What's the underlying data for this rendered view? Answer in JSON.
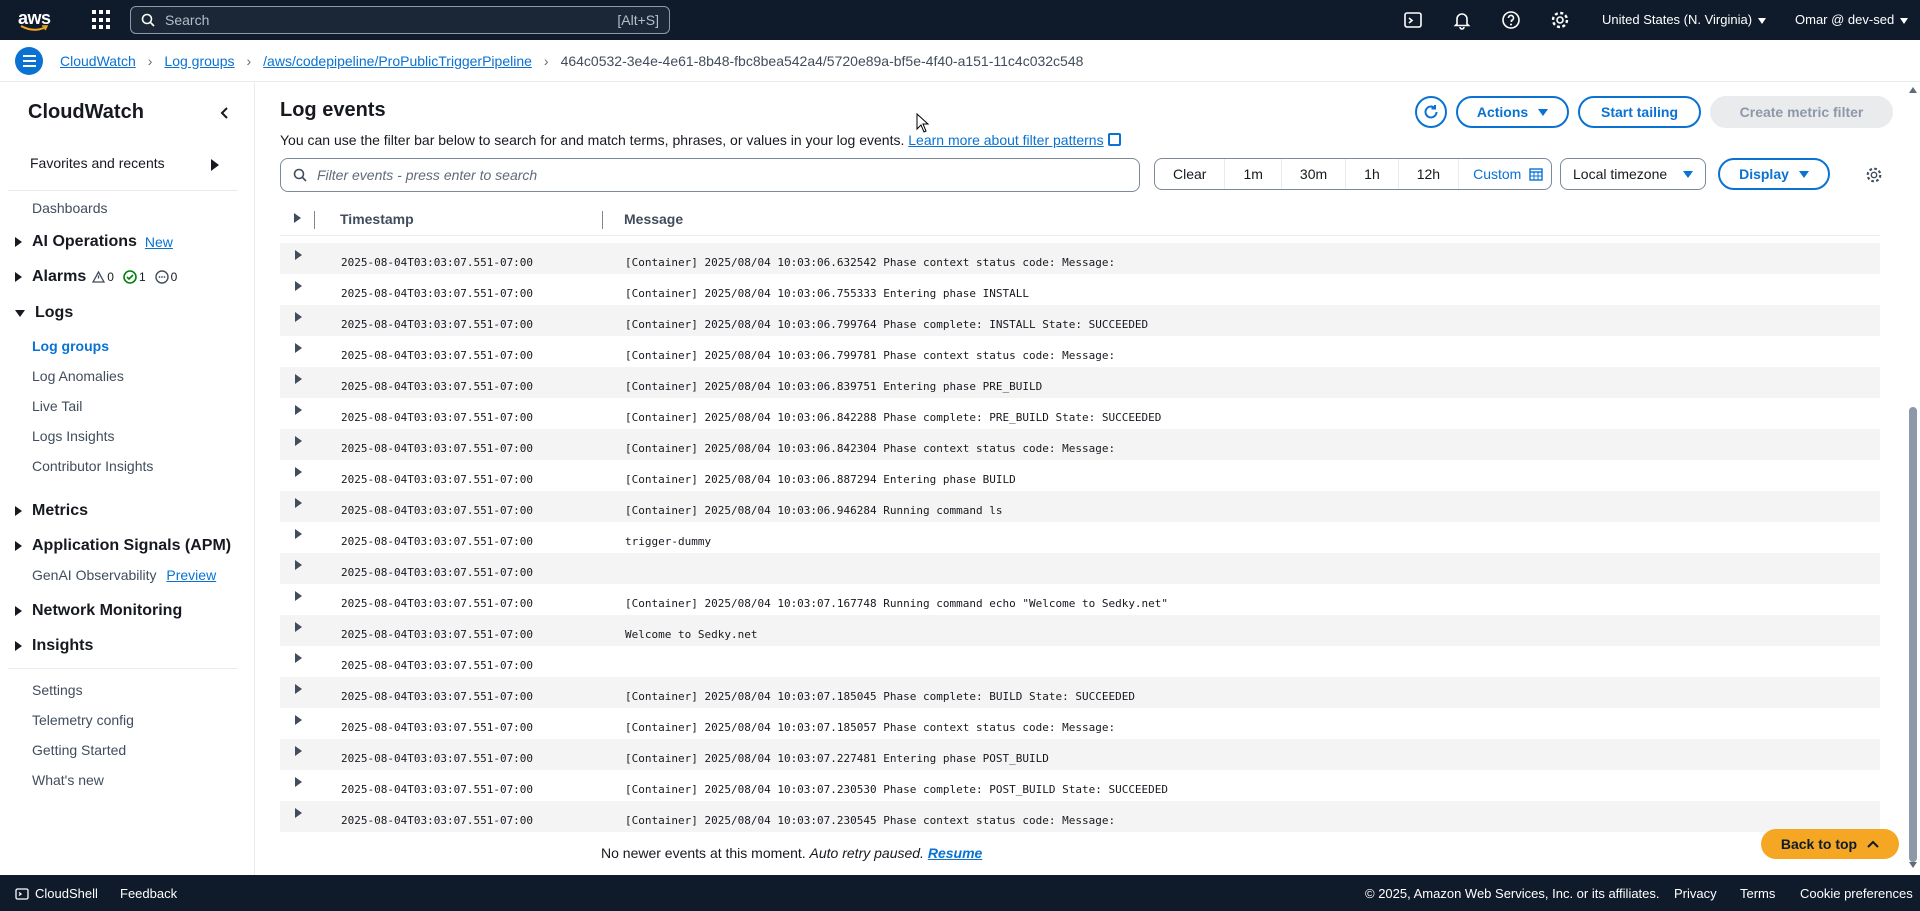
{
  "topnav": {
    "logo_text": "aws",
    "search_placeholder": "Search",
    "search_shortcut": "[Alt+S]",
    "region": "United States (N. Virginia)",
    "account": "Omar @ dev-sed",
    "icons": [
      "cloudshell-icon",
      "bell-icon",
      "help-icon",
      "gear-icon"
    ]
  },
  "breadcrumb": {
    "items": [
      "CloudWatch",
      "Log groups",
      "/aws/codepipeline/ProPublicTriggerPipeline"
    ],
    "current": "464c0532-3e4e-4e61-8b48-fbc8bea542a4/5720e89a-bf5e-4f40-a151-11c4c032c548"
  },
  "sidebar": {
    "title": "CloudWatch",
    "favorites": "Favorites and recents",
    "dashboards": "Dashboards",
    "ai_ops": "AI Operations",
    "ai_ops_badge": "New",
    "alarms": "Alarms",
    "alarm_counts": {
      "alarm": "0",
      "ok": "1",
      "insufficient": "0"
    },
    "logs": "Logs",
    "logs_items": [
      "Log groups",
      "Log Anomalies",
      "Live Tail",
      "Logs Insights",
      "Contributor Insights"
    ],
    "metrics": "Metrics",
    "app_signals": "Application Signals (APM)",
    "genai": "GenAI Observability",
    "genai_badge": "Preview",
    "network": "Network Monitoring",
    "insights": "Insights",
    "bottom_items": [
      "Settings",
      "Telemetry config",
      "Getting Started",
      "What's new"
    ]
  },
  "main": {
    "title": "Log events",
    "description": "You can use the filter bar below to search for and match terms, phrases, or values in your log events.",
    "learn_more": "Learn more about filter patterns",
    "actions_label": "Actions",
    "start_tailing_label": "Start tailing",
    "create_metric_label": "Create metric filter",
    "filter_placeholder": "Filter events - press enter to search",
    "ranges": [
      "Clear",
      "1m",
      "30m",
      "1h",
      "12h",
      "Custom"
    ],
    "selected_range": "Custom",
    "timezone": "Local timezone",
    "display_label": "Display",
    "col_timestamp": "Timestamp",
    "col_message": "Message",
    "no_newer": "No newer events at this moment.",
    "auto_retry": "Auto retry paused.",
    "resume": "Resume",
    "back_to_top": "Back to top"
  },
  "log_rows": [
    {
      "ts": "2025-08-04T03:03:07.551-07:00",
      "msg": "[Container] 2025/08/04 10:03:06.632542 Phase context status code: Message:"
    },
    {
      "ts": "2025-08-04T03:03:07.551-07:00",
      "msg": "[Container] 2025/08/04 10:03:06.755333 Entering phase INSTALL"
    },
    {
      "ts": "2025-08-04T03:03:07.551-07:00",
      "msg": "[Container] 2025/08/04 10:03:06.799764 Phase complete: INSTALL State: SUCCEEDED"
    },
    {
      "ts": "2025-08-04T03:03:07.551-07:00",
      "msg": "[Container] 2025/08/04 10:03:06.799781 Phase context status code: Message:"
    },
    {
      "ts": "2025-08-04T03:03:07.551-07:00",
      "msg": "[Container] 2025/08/04 10:03:06.839751 Entering phase PRE_BUILD"
    },
    {
      "ts": "2025-08-04T03:03:07.551-07:00",
      "msg": "[Container] 2025/08/04 10:03:06.842288 Phase complete: PRE_BUILD State: SUCCEEDED"
    },
    {
      "ts": "2025-08-04T03:03:07.551-07:00",
      "msg": "[Container] 2025/08/04 10:03:06.842304 Phase context status code: Message:"
    },
    {
      "ts": "2025-08-04T03:03:07.551-07:00",
      "msg": "[Container] 2025/08/04 10:03:06.887294 Entering phase BUILD"
    },
    {
      "ts": "2025-08-04T03:03:07.551-07:00",
      "msg": "[Container] 2025/08/04 10:03:06.946284 Running command ls"
    },
    {
      "ts": "2025-08-04T03:03:07.551-07:00",
      "msg": "trigger-dummy"
    },
    {
      "ts": "2025-08-04T03:03:07.551-07:00",
      "msg": ""
    },
    {
      "ts": "2025-08-04T03:03:07.551-07:00",
      "msg": "[Container] 2025/08/04 10:03:07.167748 Running command echo \"Welcome to Sedky.net\""
    },
    {
      "ts": "2025-08-04T03:03:07.551-07:00",
      "msg": "Welcome to Sedky.net"
    },
    {
      "ts": "2025-08-04T03:03:07.551-07:00",
      "msg": ""
    },
    {
      "ts": "2025-08-04T03:03:07.551-07:00",
      "msg": "[Container] 2025/08/04 10:03:07.185045 Phase complete: BUILD State: SUCCEEDED"
    },
    {
      "ts": "2025-08-04T03:03:07.551-07:00",
      "msg": "[Container] 2025/08/04 10:03:07.185057 Phase context status code: Message:"
    },
    {
      "ts": "2025-08-04T03:03:07.551-07:00",
      "msg": "[Container] 2025/08/04 10:03:07.227481 Entering phase POST_BUILD"
    },
    {
      "ts": "2025-08-04T03:03:07.551-07:00",
      "msg": "[Container] 2025/08/04 10:03:07.230530 Phase complete: POST_BUILD State: SUCCEEDED"
    },
    {
      "ts": "2025-08-04T03:03:07.551-07:00",
      "msg": "[Container] 2025/08/04 10:03:07.230545 Phase context status code: Message:"
    }
  ],
  "footer": {
    "cloudshell": "CloudShell",
    "feedback": "Feedback",
    "copyright": "© 2025, Amazon Web Services, Inc. or its affiliates.",
    "privacy": "Privacy",
    "terms": "Terms",
    "cookies": "Cookie preferences"
  },
  "colors": {
    "nav_bg": "#0f1b2a",
    "link": "#0972d3",
    "back_to_top": "#f5a623"
  }
}
